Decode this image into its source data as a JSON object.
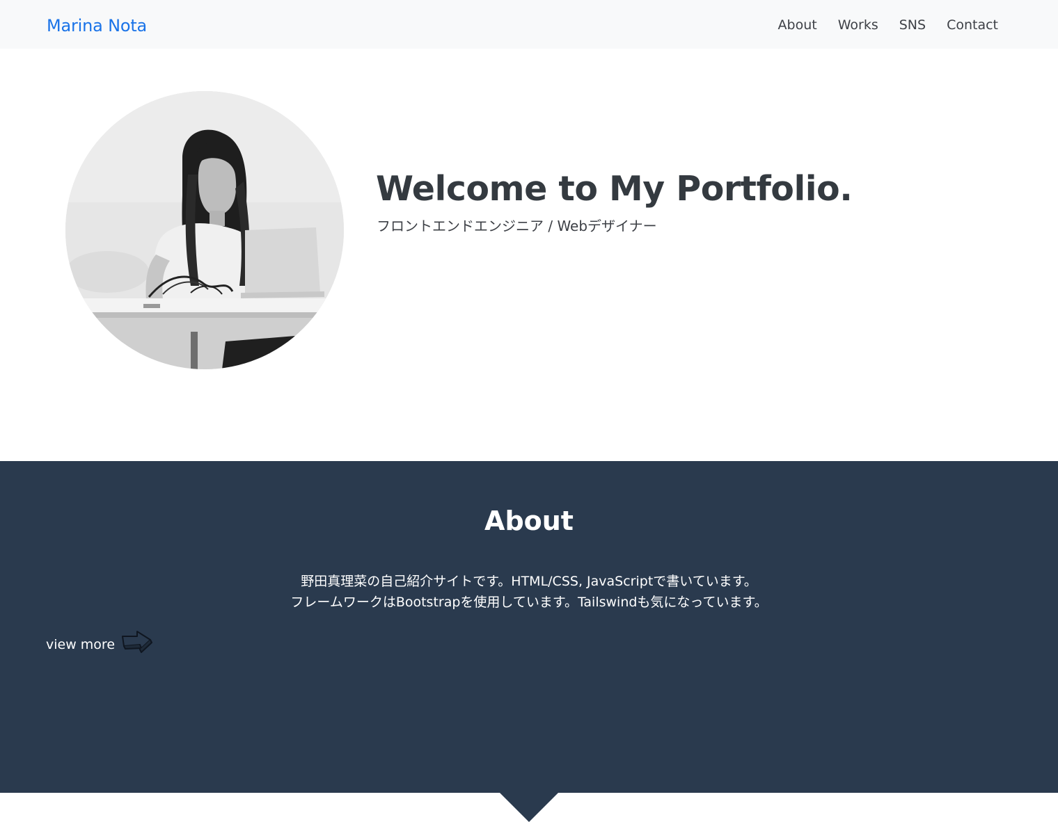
{
  "navbar": {
    "brand": "Marina Nota",
    "links": [
      "About",
      "Works",
      "SNS",
      "Contact"
    ]
  },
  "hero": {
    "title": "Welcome to My Portfolio.",
    "subtitle": "フロントエンドエンジニア / Webデザイナー"
  },
  "about": {
    "title": "About",
    "lines": [
      "野田真理菜の自己紹介サイトです。HTML/CSS, JavaScriptで書いています。",
      "フレームワークはBootstrapを使用しています。Tailswindも気になっています。"
    ],
    "view_more": "view more"
  },
  "colors": {
    "brand": "#1a73e8",
    "navbar_bg": "#f8f9fa",
    "about_bg": "#2a3a4e",
    "heading": "#343a40"
  },
  "icons": {
    "view_more": "right-arrow-icon",
    "section_divider": "down-triangle-icon"
  }
}
